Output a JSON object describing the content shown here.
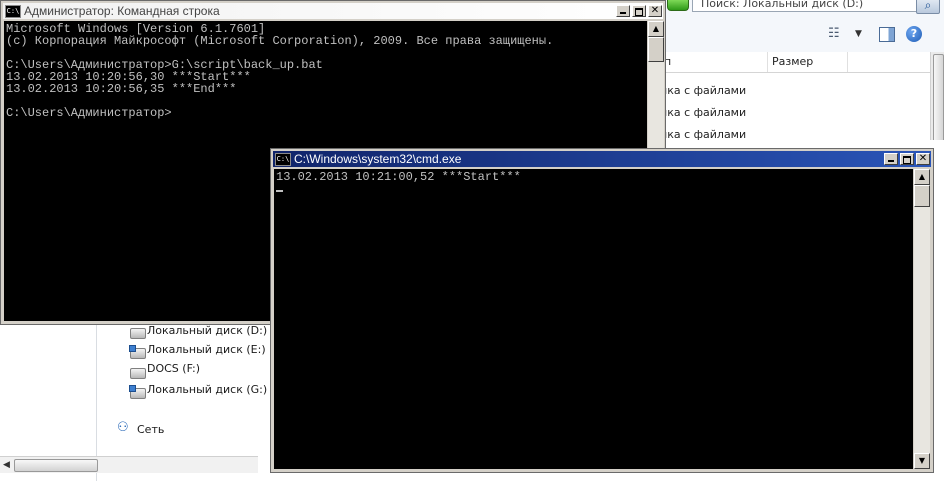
{
  "explorer": {
    "search_placeholder": "Поиск: Локальный диск (D:)",
    "columns": {
      "name": "п",
      "size": "Размер"
    },
    "rows": [
      "пка с файлами",
      "пка с файлами",
      "пка с файлами"
    ],
    "nav_items": [
      {
        "label": "Локальный диск (D:)",
        "icon": "drive-icon"
      },
      {
        "label": "Локальный диск (E:)",
        "icon": "network-drive-icon"
      },
      {
        "label": "DOCS (F:)",
        "icon": "drive-icon"
      },
      {
        "label": "Локальный диск (G:)",
        "icon": "network-drive-icon"
      }
    ],
    "network_label": "Сеть"
  },
  "cmd1": {
    "title": "Администратор: Командная строка",
    "icon_label": "C:\\",
    "lines": [
      "Microsoft Windows [Version 6.1.7601]",
      "(c) Корпорация Майкрософт (Microsoft Corporation), 2009. Все права защищены.",
      "",
      "C:\\Users\\Администратор>G:\\script\\back_up.bat",
      "13.02.2013 10:20:56,30 ***Start***",
      "13.02.2013 10:20:56,35 ***End***",
      "",
      "C:\\Users\\Администратор>"
    ]
  },
  "cmd2": {
    "title": "C:\\Windows\\system32\\cmd.exe",
    "icon_label": "C:\\",
    "lines": [
      "13.02.2013 10:21:00,52 ***Start***"
    ]
  },
  "controls": {
    "close": "✕",
    "up": "▲",
    "down": "▼",
    "left": "◀"
  },
  "colors": {
    "console_bg": "#000000",
    "console_fg": "#c0c0c0",
    "active_title_start": "#10246a",
    "active_title_end": "#2a55b8"
  }
}
